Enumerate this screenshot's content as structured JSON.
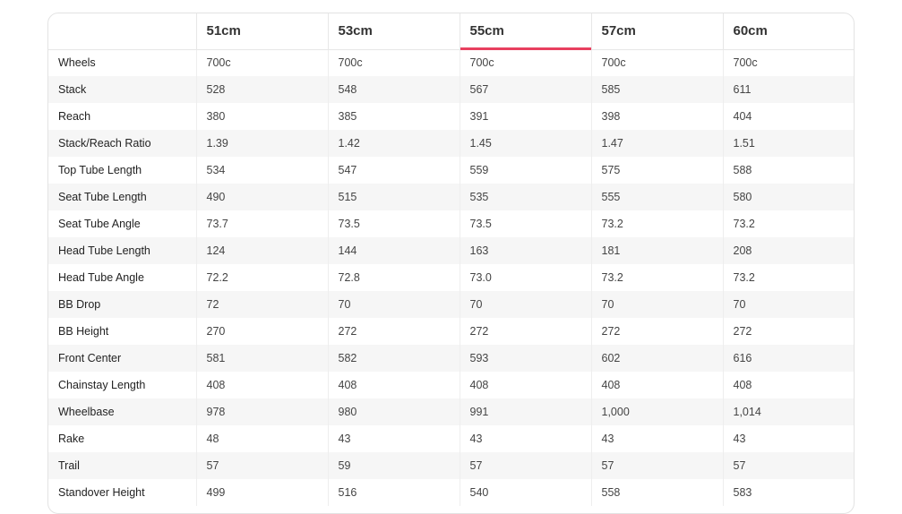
{
  "table": {
    "columns": [
      "",
      "51cm",
      "53cm",
      "55cm",
      "57cm",
      "60cm"
    ],
    "active_column": "55cm",
    "accent_color": "#e8405f",
    "rows": [
      {
        "label": "Wheels",
        "values": [
          "700c",
          "700c",
          "700c",
          "700c",
          "700c"
        ]
      },
      {
        "label": "Stack",
        "values": [
          "528",
          "548",
          "567",
          "585",
          "611"
        ]
      },
      {
        "label": "Reach",
        "values": [
          "380",
          "385",
          "391",
          "398",
          "404"
        ]
      },
      {
        "label": "Stack/Reach Ratio",
        "values": [
          "1.39",
          "1.42",
          "1.45",
          "1.47",
          "1.51"
        ]
      },
      {
        "label": "Top Tube Length",
        "values": [
          "534",
          "547",
          "559",
          "575",
          "588"
        ]
      },
      {
        "label": "Seat Tube Length",
        "values": [
          "490",
          "515",
          "535",
          "555",
          "580"
        ]
      },
      {
        "label": "Seat Tube Angle",
        "values": [
          "73.7",
          "73.5",
          "73.5",
          "73.2",
          "73.2"
        ]
      },
      {
        "label": "Head Tube Length",
        "values": [
          "124",
          "144",
          "163",
          "181",
          "208"
        ]
      },
      {
        "label": "Head Tube Angle",
        "values": [
          "72.2",
          "72.8",
          "73.0",
          "73.2",
          "73.2"
        ]
      },
      {
        "label": "BB Drop",
        "values": [
          "72",
          "70",
          "70",
          "70",
          "70"
        ]
      },
      {
        "label": "BB Height",
        "values": [
          "270",
          "272",
          "272",
          "272",
          "272"
        ]
      },
      {
        "label": "Front Center",
        "values": [
          "581",
          "582",
          "593",
          "602",
          "616"
        ]
      },
      {
        "label": "Chainstay Length",
        "values": [
          "408",
          "408",
          "408",
          "408",
          "408"
        ]
      },
      {
        "label": "Wheelbase",
        "values": [
          "978",
          "980",
          "991",
          "1,000",
          "1,014"
        ]
      },
      {
        "label": "Rake",
        "values": [
          "48",
          "43",
          "43",
          "43",
          "43"
        ]
      },
      {
        "label": "Trail",
        "values": [
          "57",
          "59",
          "57",
          "57",
          "57"
        ]
      },
      {
        "label": "Standover Height",
        "values": [
          "499",
          "516",
          "540",
          "558",
          "583"
        ]
      }
    ]
  }
}
